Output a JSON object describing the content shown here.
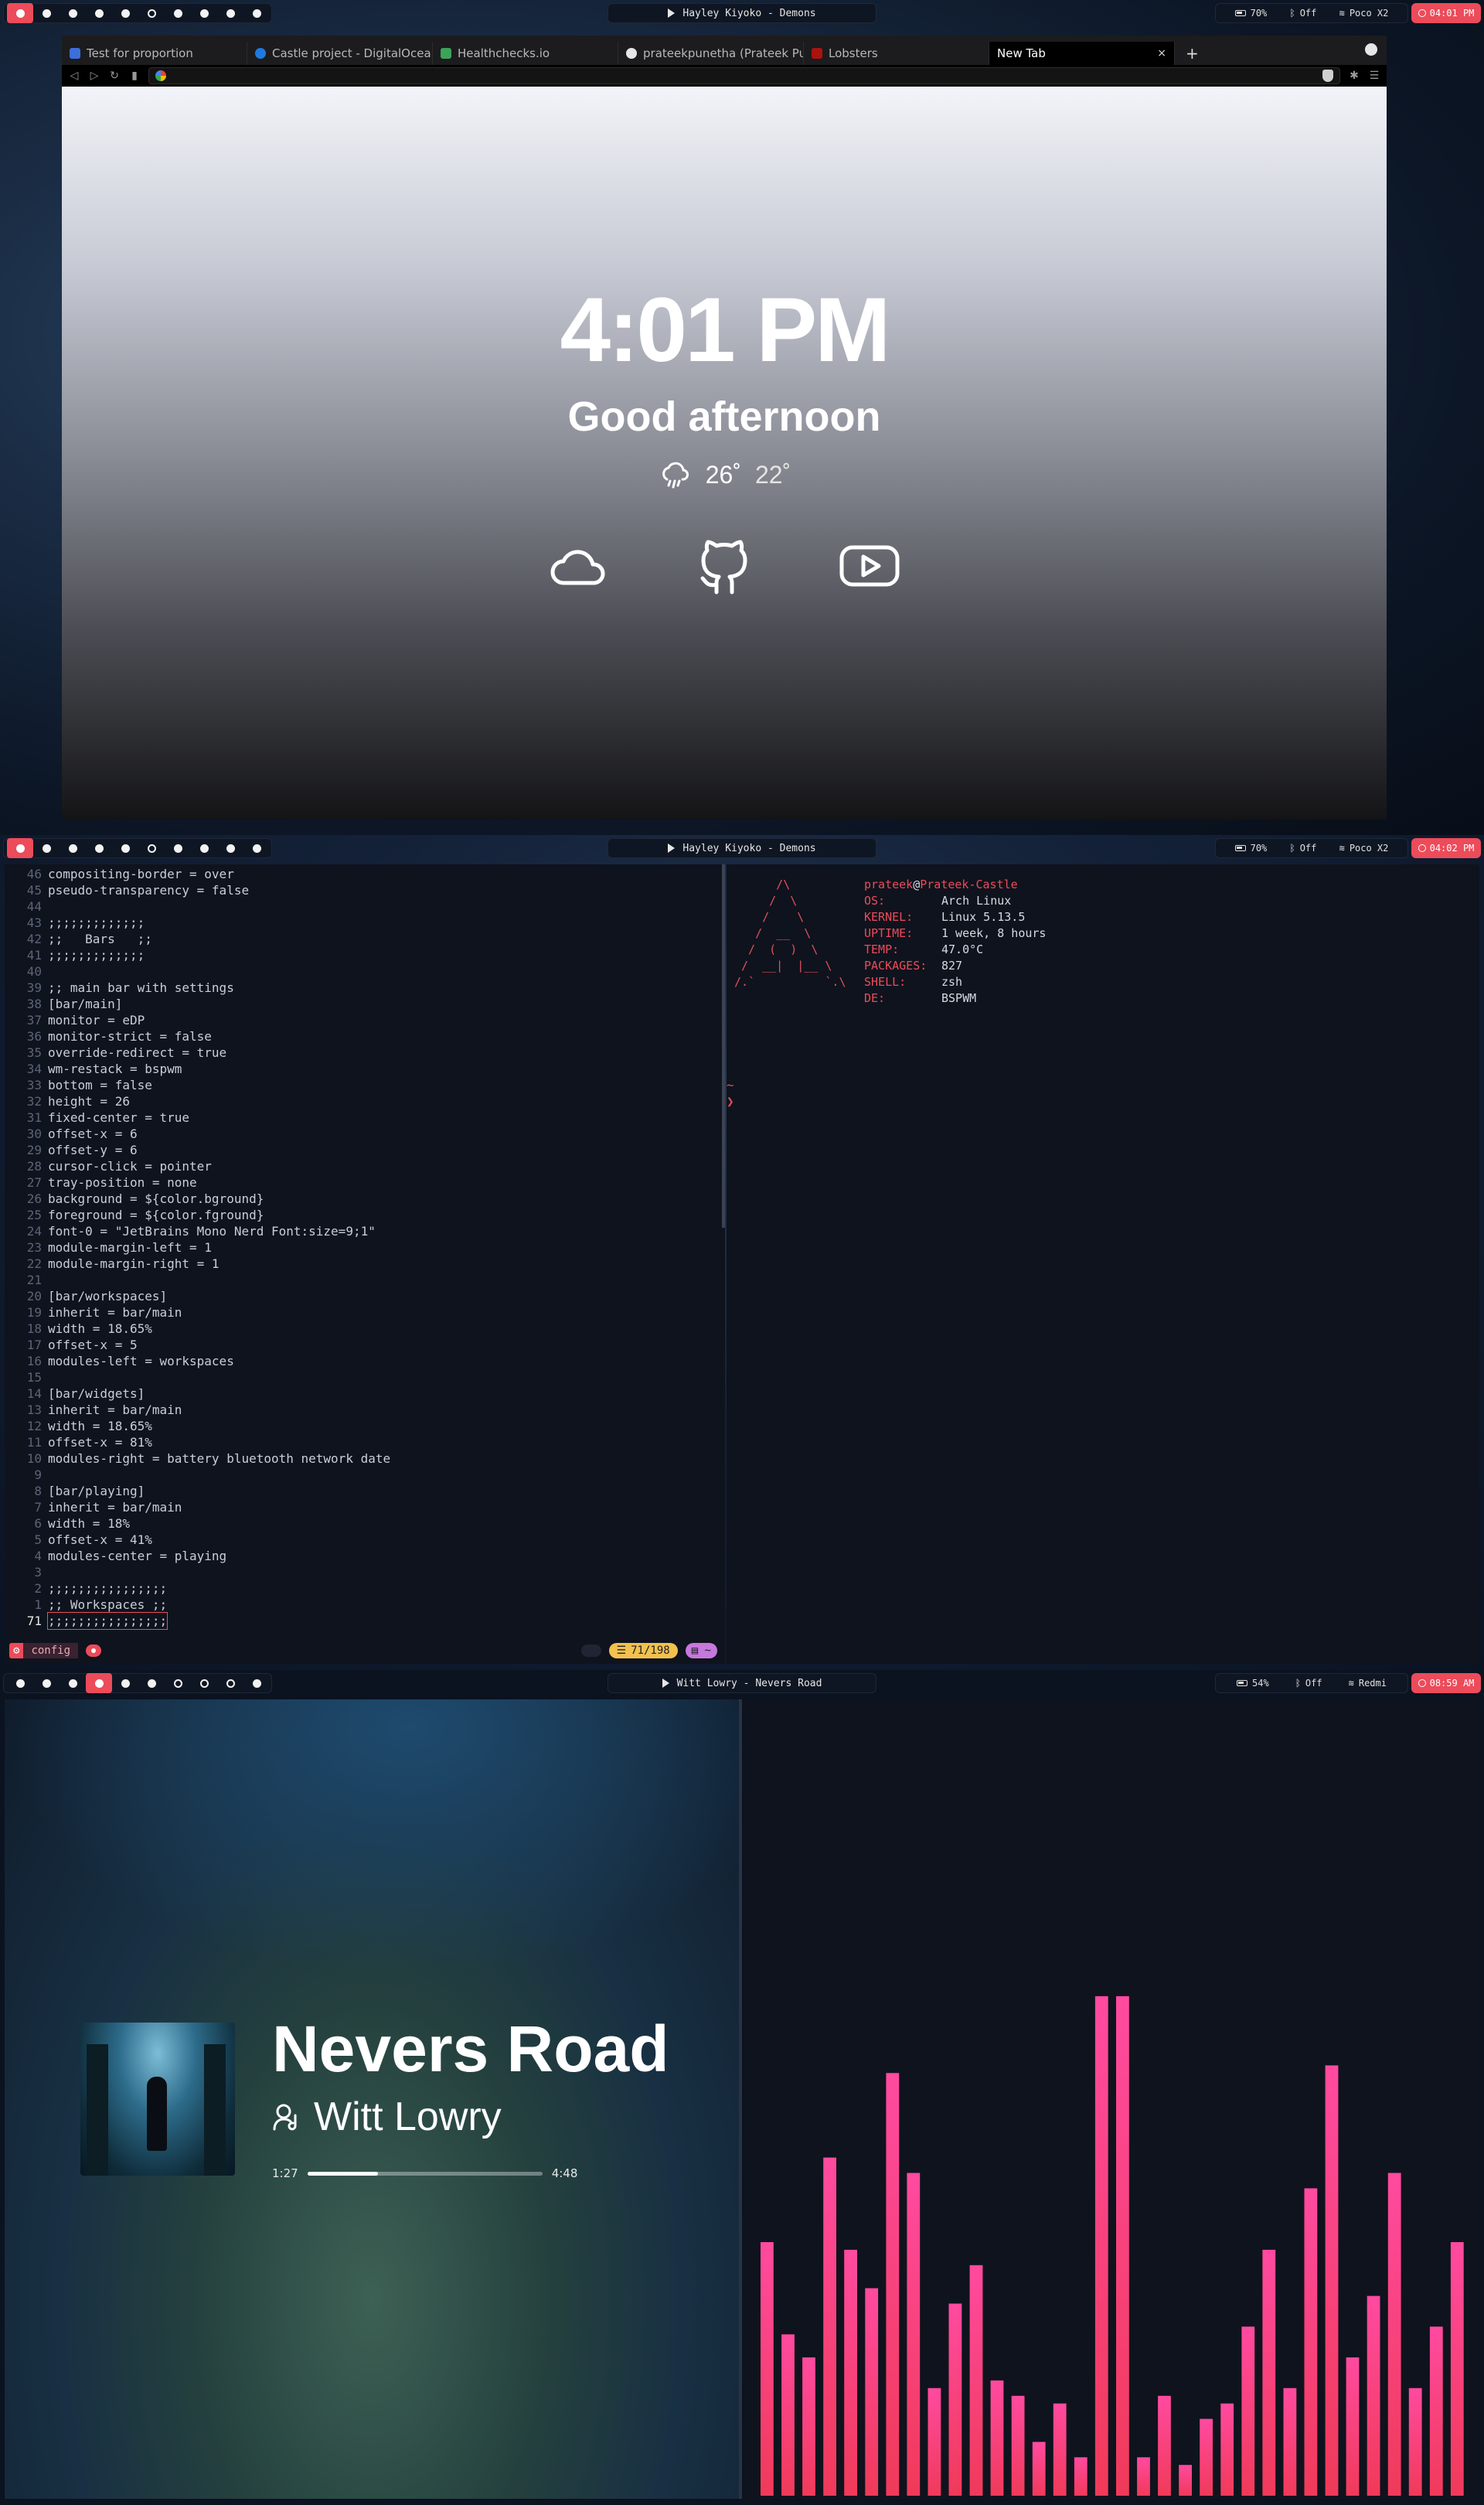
{
  "screens": [
    {
      "bar": {
        "workspaces": [
          {
            "state": "active"
          },
          {
            "state": "filled"
          },
          {
            "state": "filled"
          },
          {
            "state": "filled"
          },
          {
            "state": "filled"
          },
          {
            "state": "empty"
          },
          {
            "state": "filled"
          },
          {
            "state": "filled"
          },
          {
            "state": "filled"
          },
          {
            "state": "filled"
          }
        ],
        "now_playing": "Hayley Kiyoko - Demons",
        "battery": "70%",
        "bluetooth": "Off",
        "wifi": "Poco X2",
        "clock": "04:01 PM"
      }
    },
    {
      "bar": {
        "workspaces": [
          {
            "state": "active"
          },
          {
            "state": "filled"
          },
          {
            "state": "filled"
          },
          {
            "state": "filled"
          },
          {
            "state": "filled"
          },
          {
            "state": "empty"
          },
          {
            "state": "filled"
          },
          {
            "state": "filled"
          },
          {
            "state": "filled"
          },
          {
            "state": "filled"
          }
        ],
        "now_playing": "Hayley Kiyoko - Demons",
        "battery": "70%",
        "bluetooth": "Off",
        "wifi": "Poco X2",
        "clock": "04:02 PM"
      }
    },
    {
      "bar": {
        "workspaces": [
          {
            "state": "filled"
          },
          {
            "state": "filled"
          },
          {
            "state": "filled"
          },
          {
            "state": "active"
          },
          {
            "state": "filled"
          },
          {
            "state": "filled"
          },
          {
            "state": "empty"
          },
          {
            "state": "empty"
          },
          {
            "state": "empty"
          },
          {
            "state": "filled"
          }
        ],
        "now_playing": "Witt Lowry - Nevers Road",
        "battery": "54%",
        "bluetooth": "Off",
        "wifi": "Redmi",
        "clock": "08:59 AM"
      }
    }
  ],
  "browser": {
    "tabs": [
      {
        "label": "Test for proportion",
        "favicon_color": "#3b6fd9"
      },
      {
        "label": "Castle project - DigitalOcean",
        "favicon_color": "#1f7ae0"
      },
      {
        "label": "Healthchecks.io",
        "favicon_color": "#3ca35a"
      },
      {
        "label": "prateekpunetha (Prateek Punetha)",
        "favicon_color": "#e6e6e6"
      },
      {
        "label": "Lobsters",
        "favicon_color": "#ac130d"
      }
    ],
    "active_tab": "New Tab",
    "new_tab_symbol": "+",
    "close_symbol": "×",
    "url_value": "",
    "newtab_page": {
      "time": "4:01 PM",
      "greeting": "Good afternoon",
      "temp_high": "26˚",
      "temp_low": "22˚",
      "quick_links": [
        {
          "icon": "cloud-icon"
        },
        {
          "icon": "github-icon"
        },
        {
          "icon": "youtube-icon"
        }
      ]
    }
  },
  "editor": {
    "lines": [
      {
        "n": "46",
        "t": "compositing-border = over"
      },
      {
        "n": "45",
        "t": "pseudo-transparency = false"
      },
      {
        "n": "44",
        "t": ""
      },
      {
        "n": "43",
        "t": ";;;;;;;;;;;;;"
      },
      {
        "n": "42",
        "t": ";;   Bars   ;;"
      },
      {
        "n": "41",
        "t": ";;;;;;;;;;;;;"
      },
      {
        "n": "40",
        "t": ""
      },
      {
        "n": "39",
        "t": ";; main bar with settings"
      },
      {
        "n": "38",
        "t": "[bar/main]"
      },
      {
        "n": "37",
        "t": "monitor = eDP"
      },
      {
        "n": "36",
        "t": "monitor-strict = false"
      },
      {
        "n": "35",
        "t": "override-redirect = true"
      },
      {
        "n": "34",
        "t": "wm-restack = bspwm"
      },
      {
        "n": "33",
        "t": "bottom = false"
      },
      {
        "n": "32",
        "t": "height = 26"
      },
      {
        "n": "31",
        "t": "fixed-center = true"
      },
      {
        "n": "30",
        "t": "offset-x = 6"
      },
      {
        "n": "29",
        "t": "offset-y = 6"
      },
      {
        "n": "28",
        "t": "cursor-click = pointer"
      },
      {
        "n": "27",
        "t": "tray-position = none"
      },
      {
        "n": "26",
        "t": "background = ${color.bground}"
      },
      {
        "n": "25",
        "t": "foreground = ${color.fground}"
      },
      {
        "n": "24",
        "t": "font-0 = \"JetBrains Mono Nerd Font:size=9;1\""
      },
      {
        "n": "23",
        "t": "module-margin-left = 1"
      },
      {
        "n": "22",
        "t": "module-margin-right = 1"
      },
      {
        "n": "21",
        "t": ""
      },
      {
        "n": "20",
        "t": "[bar/workspaces]"
      },
      {
        "n": "19",
        "t": "inherit = bar/main"
      },
      {
        "n": "18",
        "t": "width = 18.65%"
      },
      {
        "n": "17",
        "t": "offset-x = 5"
      },
      {
        "n": "16",
        "t": "modules-left = workspaces"
      },
      {
        "n": "15",
        "t": ""
      },
      {
        "n": "14",
        "t": "[bar/widgets]"
      },
      {
        "n": "13",
        "t": "inherit = bar/main"
      },
      {
        "n": "12",
        "t": "width = 18.65%"
      },
      {
        "n": "11",
        "t": "offset-x = 81%"
      },
      {
        "n": "10",
        "t": "modules-right = battery bluetooth network date"
      },
      {
        "n": "9",
        "t": ""
      },
      {
        "n": "8",
        "t": "[bar/playing]"
      },
      {
        "n": "7",
        "t": "inherit = bar/main"
      },
      {
        "n": "6",
        "t": "width = 18%"
      },
      {
        "n": "5",
        "t": "offset-x = 41%"
      },
      {
        "n": "4",
        "t": "modules-center = playing"
      },
      {
        "n": "3",
        "t": ""
      },
      {
        "n": "2",
        "t": ";;;;;;;;;;;;;;;;"
      },
      {
        "n": "1",
        "t": ";; Workspaces ;;"
      }
    ],
    "current_line_number": "71",
    "current_line_text": ";;;;;;;;;;;;;;;;",
    "statusline": {
      "file": "config",
      "position": "71/198"
    }
  },
  "fetch": {
    "ascii": "      /\\\n     /  \\\n    /    \\\n   /  __  \\\n  /  (  )  \\\n /  __|  |__ \\\n/.`          `.\\",
    "user": "prateek",
    "host": "Prateek-Castle",
    "rows": [
      {
        "k": "OS:",
        "v": "Arch Linux"
      },
      {
        "k": "KERNEL:",
        "v": "Linux 5.13.5"
      },
      {
        "k": "UPTIME:",
        "v": "1 week, 8 hours"
      },
      {
        "k": "TEMP:",
        "v": "47.0°C"
      },
      {
        "k": "PACKAGES:",
        "v": "827"
      },
      {
        "k": "SHELL:",
        "v": "zsh"
      },
      {
        "k": "DE:",
        "v": "BSPWM"
      }
    ],
    "prompt": "~\n❯"
  },
  "player": {
    "song": "Nevers Road",
    "artist": "Witt Lowry",
    "elapsed": "1:27",
    "duration": "4:48",
    "progress": 0.302
  },
  "visualizer": {
    "bar_heights": [
      0.33,
      0.21,
      0.18,
      0.44,
      0.32,
      0.27,
      0.55,
      0.42,
      0.14,
      0.25,
      0.3,
      0.15,
      0.13,
      0.07,
      0.12,
      0.05,
      0.65,
      0.65,
      0.05,
      0.13,
      0.04,
      0.1,
      0.12,
      0.22,
      0.32,
      0.14,
      0.4,
      0.56,
      0.18,
      0.26,
      0.42,
      0.14,
      0.22,
      0.33
    ],
    "color_bottom": "#f03a5a",
    "color_top": "#ff4aa0"
  }
}
